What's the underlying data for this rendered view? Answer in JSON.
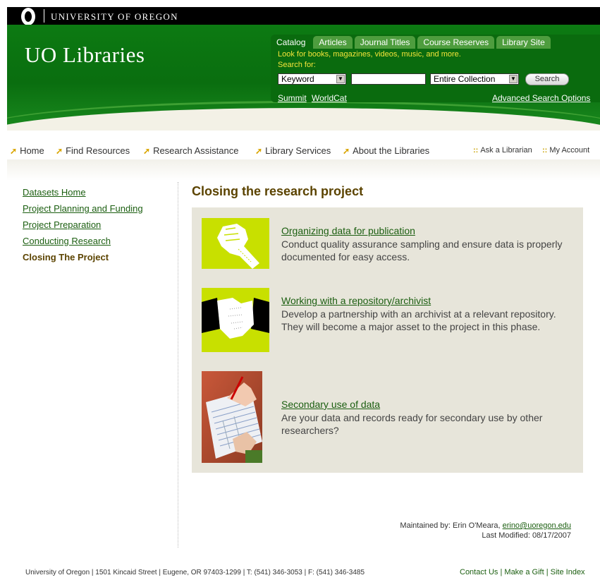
{
  "topbar": {
    "university_name": "UNIVERSITY OF OREGON"
  },
  "header": {
    "site_title": "UO Libraries"
  },
  "search": {
    "tabs": [
      "Catalog",
      "Articles",
      "Journal Titles",
      "Course Reserves",
      "Library Site"
    ],
    "active_tab": "Catalog",
    "hint": "Look for books, magazines, videos, music, and more.",
    "search_for_label": "Search for:",
    "type_selected": "Keyword",
    "query_value": "",
    "scope_selected": "Entire Collection",
    "button_label": "Search",
    "links": {
      "summit": "Summit",
      "worldcat": "WorldCat",
      "advanced": "Advanced Search Options"
    }
  },
  "nav": {
    "items": [
      "Home",
      "Find Resources",
      "Research Assistance",
      "Library Services",
      "About the Libraries"
    ],
    "utility": [
      "Ask a Librarian",
      "My Account"
    ],
    "utility_separator": "::"
  },
  "sidebar": {
    "items": [
      "Datasets Home",
      "Project Planning and Funding",
      "Project Preparation",
      "Conducting Research",
      "Closing The Project"
    ],
    "current": "Closing The Project"
  },
  "main": {
    "title": "Closing the research project",
    "items": [
      {
        "title": "Organizing data for publication",
        "description": "Conduct quality assurance sampling and ensure data is properly documented for easy access.",
        "icon": "fist-icon"
      },
      {
        "title": "Working with a repository/archivist",
        "description": "Develop a partnership with an archivist at a relevant repository. They will become a major asset to the project in this phase.",
        "icon": "handshake-icon"
      },
      {
        "title": "Secondary use of data",
        "description": "Are your data and records ready for secondary use by other researchers?",
        "icon": "writing-hand-photo"
      }
    ]
  },
  "maintainer": {
    "label": "Maintained by: Erin O'Meara,",
    "email": "erino@uoregon.edu",
    "last_modified": "Last Modified: 08/17/2007"
  },
  "footer": {
    "address": "University of Oregon | 1501 Kincaid Street | Eugene, OR 97403-1299 | T: (541) 346-3053 | F: (541) 346-3485",
    "links": [
      "Contact Us",
      "Make a Gift",
      "Site Index"
    ],
    "separator": "|"
  },
  "colors": {
    "brand_green": "#0a6b0e",
    "accent_yellow": "#d9a500",
    "lime": "#c8e000",
    "heading_brown": "#5b4300",
    "content_bg": "#e7e5da"
  }
}
